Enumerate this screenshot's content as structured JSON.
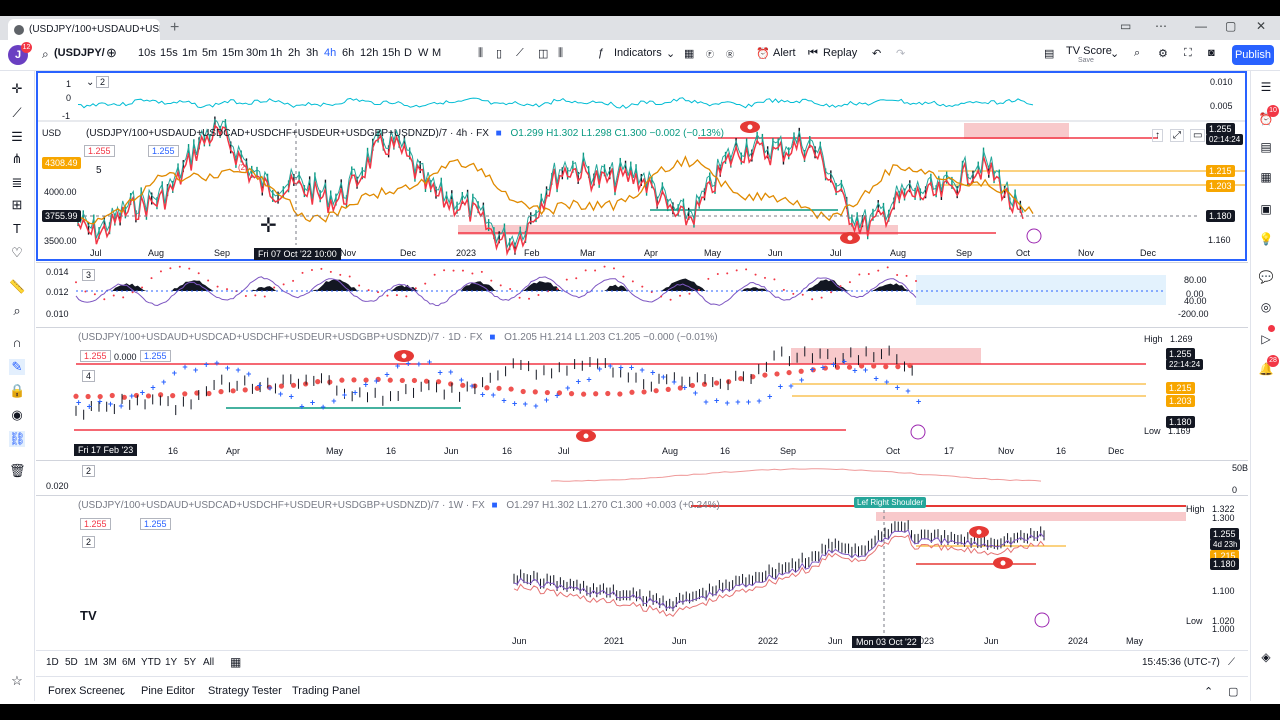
{
  "browser": {
    "tab_title": "(USDJPY/100+USDAUD+USDC",
    "new_tab": "+"
  },
  "toolbar": {
    "avatar_letter": "J",
    "avatar_badge": "12",
    "symbol": "(USDJPY/",
    "intervals": [
      "10s",
      "15s",
      "1m",
      "5m",
      "15m",
      "30m",
      "1h",
      "2h",
      "3h",
      "4h",
      "6h",
      "12h",
      "15h",
      "D",
      "W",
      "M"
    ],
    "active_interval": "4h",
    "indicators_label": "Indicators",
    "alert_label": "Alert",
    "replay_label": "Replay",
    "tvscore_label": "TV Score",
    "tvscore_sub": "Save",
    "publish_label": "Publish"
  },
  "pane1": {
    "title": "(USDJPY/100+USDAUD+USDCAD+USDCHF+USDEUR+USDGBP+USDNZD)/7 · 4h · FX",
    "ohlc": "O1.299 H1.302 L1.298 C1.300 −0.002 (−0.13%)",
    "price1": "1.255",
    "price2": "1.255",
    "currency": "USD",
    "indicator_counter": "2",
    "osc_axis": [
      "0.010",
      "0.005"
    ],
    "osc_left": [
      "1",
      "0",
      "-1"
    ],
    "left_axis": [
      "4308.49",
      "4000.00",
      "3755.99",
      "3500.00"
    ],
    "right_labels": [
      {
        "text": "1.255",
        "sub": "02:14:24",
        "color": "#131722"
      },
      {
        "text": "1.215",
        "color": "#f7a600"
      },
      {
        "text": "1.203",
        "color": "#f7a600"
      },
      {
        "text": "1.180",
        "color": "#131722"
      }
    ],
    "right_last": "1.160",
    "month_labels": [
      "Jul",
      "Aug",
      "Sep",
      "Oct",
      "Nov",
      "Dec",
      "2023",
      "Feb",
      "Mar",
      "Apr",
      "May",
      "Jun",
      "Jul",
      "Aug",
      "Sep",
      "Oct",
      "Nov",
      "Dec"
    ],
    "cursor_date": "Fri 07 Oct '22   10:00",
    "annotation_2": "(2)",
    "annotation_5": "5"
  },
  "pane2": {
    "left_axis": [
      "0.014",
      "0.012",
      "0.010"
    ],
    "right_axis": [
      "80.00",
      "0.00",
      "40.00",
      "-200.00"
    ],
    "counter": "3"
  },
  "pane3": {
    "title": "(USDJPY/100+USDAUD+USDCAD+USDCHF+USDEUR+USDGBP+USDNZD)/7 · 1D · FX",
    "ohlc": "O1.205 H1.214 L1.203 C1.205 −0.000 (−0.01%)",
    "price1": "1.255",
    "price_val": "0.000",
    "price2": "1.255",
    "counter": "4",
    "high_label": "High",
    "high_val": "1.269",
    "low_label": "Low",
    "low_val": "1.169",
    "right_labels": [
      {
        "text": "1.255",
        "sub": "22:14:24",
        "color": "#131722"
      },
      {
        "text": "1.215",
        "color": "#f7a600"
      },
      {
        "text": "1.203",
        "color": "#f7a600"
      },
      {
        "text": "1.180",
        "color": "#131722"
      }
    ],
    "cursor_date": "Fri 17 Feb '23",
    "date_labels": [
      "16",
      "Apr",
      "May",
      "16",
      "Jun",
      "16",
      "Jul",
      "Aug",
      "16",
      "Sep",
      "Oct",
      "17",
      "Nov",
      "16",
      "Dec"
    ]
  },
  "pane4": {
    "counter": "2",
    "left_axis": "0.020",
    "right_axis": [
      "50B",
      "0"
    ]
  },
  "pane5": {
    "title": "(USDJPY/100+USDAUD+USDCAD+USDCHF+USDEUR+USDGBP+USDNZD)/7 · 1W · FX",
    "ohlc": "O1.297 H1.302 L1.270 C1.300 +0.003 (+0.24%)",
    "price1": "1.255",
    "price2": "1.255",
    "counter": "2",
    "annotation": "Lef Right Shoulder",
    "high_label": "High",
    "high_val": "1.322",
    "right_axis_top": "1.300",
    "right_labels": [
      {
        "text": "1.255",
        "sub": "4d 23h",
        "color": "#131722"
      },
      {
        "text": "1.215",
        "color": "#f7a600"
      },
      {
        "text": "1.180",
        "color": "#131722"
      }
    ],
    "right_axis_mid": "1.100",
    "low_label": "Low",
    "low_val": "1.020",
    "right_axis_bottom": "1.000",
    "date_labels": [
      "Jun",
      "2021",
      "Jun",
      "2022",
      "Jun",
      "2023",
      "Jun",
      "2024",
      "May"
    ],
    "cursor_date": "Mon 03 Oct '22",
    "logo": "TV"
  },
  "rangebar": {
    "ranges": [
      "1D",
      "5D",
      "1M",
      "3M",
      "6M",
      "YTD",
      "1Y",
      "5Y",
      "All"
    ],
    "clock": "15:45:36 (UTC-7)"
  },
  "bottompanel": {
    "tabs": [
      "Forex Screener",
      "Pine Editor",
      "Strategy Tester",
      "Trading Panel"
    ]
  },
  "colors": {
    "accent": "#2962ff",
    "red": "#f23645",
    "green": "#089981",
    "orange": "#f7a600",
    "cyan": "#00bcd4"
  }
}
